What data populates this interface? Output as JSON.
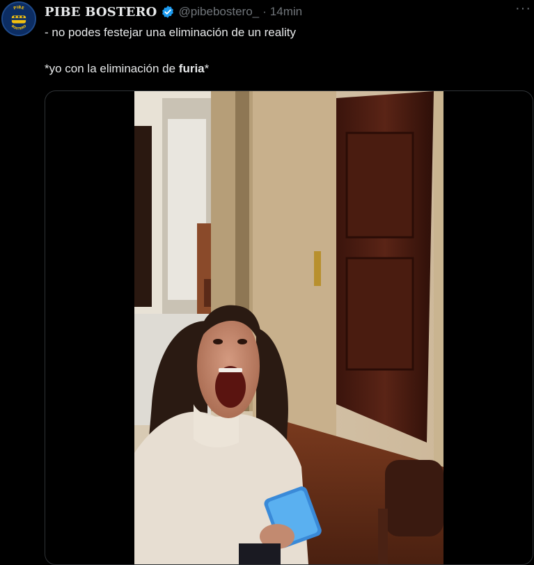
{
  "tweet": {
    "display_name": "PIBE BOSTERO",
    "handle": "@pibebostero_",
    "separator": "·",
    "time": "14min",
    "more": "···",
    "line1": "- no podes festejar una eliminación de un reality",
    "line2_prefix": "*yo con la eliminación de ",
    "line2_bold": "furia",
    "line2_suffix": "*"
  },
  "avatar": {
    "badge_top": "PIBE",
    "badge_bottom": "BOSTERO"
  },
  "colors": {
    "background": "#000000",
    "text": "#e7e9ea",
    "muted": "#71767b",
    "verified": "#1d9bf0",
    "border": "#2f3336"
  },
  "icons": {
    "verified": "verified-badge-icon",
    "more": "more-options-icon",
    "avatar": "boca-crest-avatar"
  }
}
